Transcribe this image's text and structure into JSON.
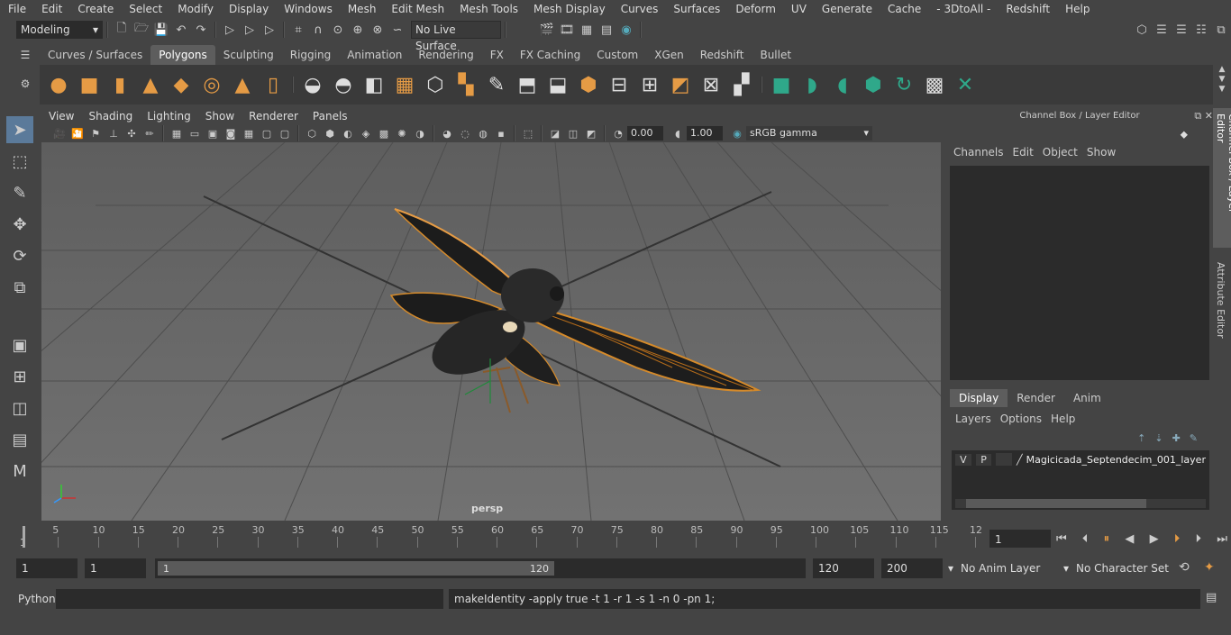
{
  "menubar": {
    "items": [
      "File",
      "Edit",
      "Create",
      "Select",
      "Modify",
      "Display",
      "Windows",
      "Mesh",
      "Edit Mesh",
      "Mesh Tools",
      "Mesh Display",
      "Curves",
      "Surfaces",
      "Deform",
      "UV",
      "Generate",
      "Cache",
      "- 3DtoAll -",
      "Redshift",
      "Help"
    ]
  },
  "status": {
    "mode": "Modeling",
    "live_surface": "No Live Surface"
  },
  "shelf": {
    "tabs": [
      "Curves / Surfaces",
      "Polygons",
      "Sculpting",
      "Rigging",
      "Animation",
      "Rendering",
      "FX",
      "FX Caching",
      "Custom",
      "XGen",
      "Redshift",
      "Bullet"
    ],
    "active_tab": "Polygons"
  },
  "viewport": {
    "menu": [
      "View",
      "Shading",
      "Lighting",
      "Show",
      "Renderer",
      "Panels"
    ],
    "exposure": "0.00",
    "gamma": "1.00",
    "color_space": "sRGB gamma",
    "camera_label": "persp"
  },
  "channel_box": {
    "title": "Channel Box / Layer Editor",
    "menu": [
      "Channels",
      "Edit",
      "Object",
      "Show"
    ],
    "layer_tabs": [
      "Display",
      "Render",
      "Anim"
    ],
    "layer_menu": [
      "Layers",
      "Options",
      "Help"
    ],
    "layer": {
      "v": "V",
      "p": "P",
      "name": "Magicicada_Septendecim_001_layer"
    }
  },
  "side_tabs": [
    "Channel Box / Layer Editor",
    "Attribute Editor"
  ],
  "timeline": {
    "ticks": [
      "5",
      "10",
      "15",
      "20",
      "25",
      "30",
      "35",
      "40",
      "45",
      "50",
      "55",
      "60",
      "65",
      "70",
      "75",
      "80",
      "85",
      "90",
      "95",
      "100",
      "105",
      "110",
      "115",
      "12"
    ],
    "start_label": "1",
    "current_frame": "1"
  },
  "range": {
    "start": "1",
    "playback_start": "1",
    "slider_start": "1",
    "slider_end": "120",
    "playback_end": "120",
    "end": "200",
    "anim_layer": "No Anim Layer",
    "character_set": "No Character Set"
  },
  "command": {
    "language": "Python",
    "result": "makeIdentity -apply true -t 1 -r 1 -s 1 -n 0 -pn 1;"
  }
}
